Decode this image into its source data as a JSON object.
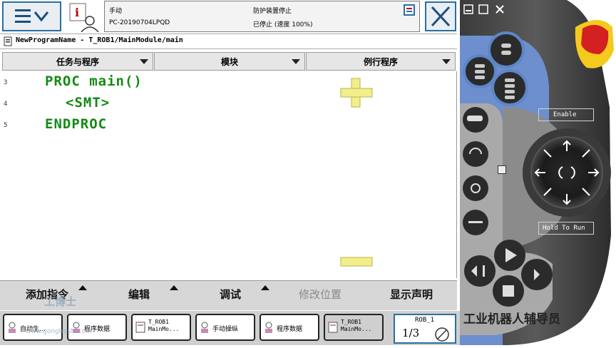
{
  "header": {
    "mode": "手动",
    "controller": "PC-20190704LPQD",
    "safety_state": "防护装置停止",
    "run_state": "已停止 (速度 100%)"
  },
  "breadcrumb": "NewProgramName - T_ROB1/MainModule/main",
  "columns": [
    "任务与程序",
    "模块",
    "例行程序"
  ],
  "editor": {
    "lines": [
      {
        "num": "3",
        "code": "PROC main()"
      },
      {
        "num": "4",
        "code": "<SMT>"
      },
      {
        "num": "5",
        "code": "ENDPROC"
      }
    ]
  },
  "bottom_menu": [
    {
      "label": "添加指令",
      "enabled": true
    },
    {
      "label": "编辑",
      "enabled": true
    },
    {
      "label": "调试",
      "enabled": true
    },
    {
      "label": "修改位置",
      "enabled": false
    },
    {
      "label": "显示声明",
      "enabled": true
    }
  ],
  "taskbar": [
    {
      "label": "自动生..."
    },
    {
      "label": "程序数据"
    },
    {
      "label": "T_ROB1\nMainMo..."
    },
    {
      "label": "手动操纵"
    },
    {
      "label": "程序数据"
    },
    {
      "label": "T_ROB1\nMainMo..."
    }
  ],
  "rob_panel": {
    "title": "ROB_1",
    "fraction": "1/3"
  },
  "pendant": {
    "enable_label": "Enable",
    "hold_label": "Hold To Run"
  },
  "watermark": {
    "text": "工业机器人辅导员",
    "left_text": "工博士",
    "left_sub": "www.gongboshi.com"
  },
  "colors": {
    "accent": "#2a6fa0",
    "code": "#138a13",
    "zoom": "#f2ee8a"
  }
}
